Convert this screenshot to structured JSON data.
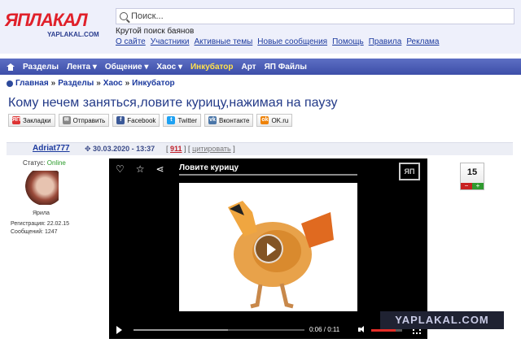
{
  "header": {
    "logo_text": "ЯПЛАКАЛ",
    "logo_sub": "YAPLAKAL.COM",
    "search_placeholder": "Поиск...",
    "tagline": "Крутой поиск баянов",
    "links": [
      "О сайте",
      "Участники",
      "Активные темы",
      "Новые сообщения",
      "Помощь",
      "Правила",
      "Реклама"
    ]
  },
  "nav": {
    "items": [
      "Разделы",
      "Лента ▾",
      "Общение ▾",
      "Хаос ▾",
      "Инкубатор",
      "Арт",
      "ЯП Файлы"
    ],
    "highlight_index": 4
  },
  "breadcrumb": [
    "Главная",
    "Разделы",
    "Хаос",
    "Инкубатор"
  ],
  "topic_title": "Кому нечем заняться,ловите курицу,нажимая на паузу",
  "share": [
    {
      "label": "Закладки",
      "icon": "bookmark-icon",
      "color": "#d33"
    },
    {
      "label": "Отправить",
      "icon": "mail-icon",
      "color": "#888"
    },
    {
      "label": "Facebook",
      "icon": "facebook-icon",
      "color": "#3b5998"
    },
    {
      "label": "Twitter",
      "icon": "twitter-icon",
      "color": "#1da1f2"
    },
    {
      "label": "Вконтакте",
      "icon": "vk-icon",
      "color": "#4a76a8"
    },
    {
      "label": "OK.ru",
      "icon": "ok-icon",
      "color": "#ee8208"
    }
  ],
  "post": {
    "author": "Adriat777",
    "date": "30.03.2020 - 13:37",
    "post_id": "911",
    "quote_label": "цитировать",
    "status_label": "Статус:",
    "status_value": "Online",
    "avatar_caption": "Ярила",
    "registered": "Регистрация: 22.02.15",
    "messages": "Сообщений: 1247",
    "rating": "15"
  },
  "video": {
    "title": "Ловите курицу",
    "logo": "ЯП",
    "time": "0:06  /  0:11",
    "progress": 0.55,
    "volume": 0.8
  },
  "watermark": "YAPLAKAL.COM",
  "colors": {
    "nav_bg": "#4657b0",
    "title": "#233a88",
    "link": "#1c3a9e",
    "accent": "#e52d27"
  }
}
